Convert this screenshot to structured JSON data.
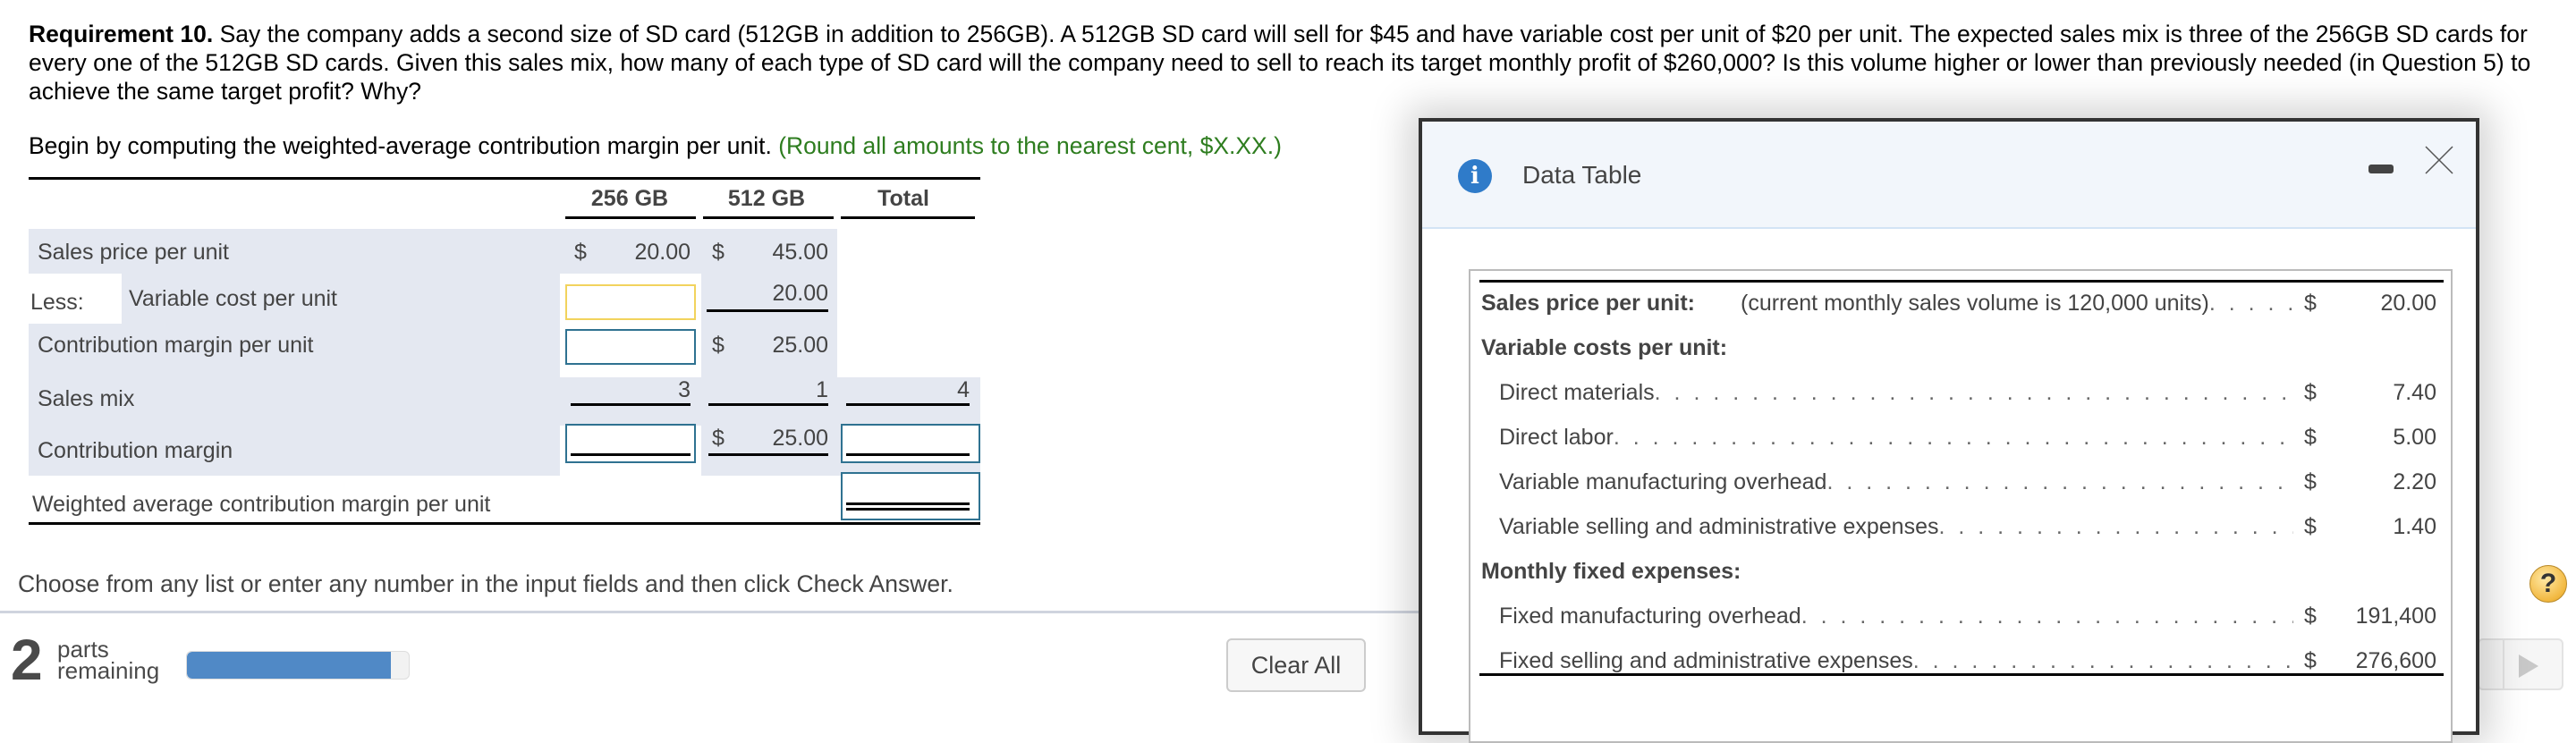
{
  "question": {
    "label": "Requirement 10.",
    "text": "Say the company adds a second size of SD card (512GB in addition to 256GB). A 512GB SD card will sell for $45 and have variable cost per unit of $20 per unit. The expected sales mix is three of the 256GB SD cards for every one of the 512GB SD cards. Given this sales mix, how many of each type of SD card will the company need to sell to reach its target monthly profit of $260,000? Is this volume higher or lower than previously needed (in Question 5) to achieve the same target profit? Why?"
  },
  "instruction": {
    "text": "Begin by computing the weighted-average contribution margin per unit.",
    "hint": "(Round all amounts to the nearest cent, $X.XX.)"
  },
  "worksheet": {
    "columns": [
      "256 GB",
      "512 GB",
      "Total"
    ],
    "rows": {
      "sales_price": {
        "label": "Sales price per unit",
        "c256_dollar": "$",
        "c256": "20.00",
        "c512_dollar": "$",
        "c512": "45.00"
      },
      "variable_cost": {
        "prefix": "Less:",
        "label": "Variable cost per unit",
        "c256_input": "",
        "c512": "20.00"
      },
      "cm_per_unit": {
        "label": "Contribution margin per unit",
        "c256_input": "",
        "c512_dollar": "$",
        "c512": "25.00"
      },
      "sales_mix": {
        "label": "Sales mix",
        "c256": "3",
        "c512": "1",
        "total": "4"
      },
      "contribution_margin": {
        "label": "Contribution margin",
        "c256_input": "",
        "c512_dollar": "$",
        "c512": "25.00",
        "total_input": ""
      },
      "weighted_avg": {
        "label": "Weighted average contribution margin per unit",
        "total_input": ""
      }
    }
  },
  "footer": {
    "choose_text": "Choose from any list or enter any number in the input fields and then click Check Answer.",
    "parts_count": "2",
    "parts_label_1": "parts",
    "parts_label_2": "remaining",
    "progress_percent": 92,
    "clear_all_label": "Clear All",
    "help_label": "?"
  },
  "modal": {
    "title": "Data Table",
    "info_glyph": "i",
    "rows": [
      {
        "label": "Sales price per unit:",
        "bold": true,
        "note": "(current monthly sales volume is 120,000 units)",
        "dots": ". . . . .",
        "dollar": "$",
        "value": "20.00"
      },
      {
        "label": "Variable costs per unit:",
        "bold": true
      },
      {
        "label": "Direct materials",
        "dots": ". . . . . . . . . . . . . . . . . . . . . . . . . . . . . . . . . . . . . . . . . . . . . . . . . . .",
        "dollar": "$",
        "value": "7.40"
      },
      {
        "label": "Direct labor",
        "dots": ". . . . . . . . . . . . . . . . . . . . . . . . . . . . . . . . . . . . . . . . . . . . . . . . . . . . .",
        "dollar": "$",
        "value": "5.00"
      },
      {
        "label": "Variable manufacturing overhead",
        "dots": ". . . . . . . . . . . . . . . . . . . . . . . . . . . . . . . . . . .",
        "dollar": "$",
        "value": "2.20"
      },
      {
        "label": "Variable selling and administrative expenses",
        "dots": ". . . . . . . . . . . . . . . . . . . . . . . . . . .",
        "dollar": "$",
        "value": "1.40"
      },
      {
        "label": "Monthly fixed expenses:",
        "bold": true
      },
      {
        "label": "Fixed manufacturing overhead",
        "dots": ". . . . . . . . . . . . . . . . . . . . . . . . . . . . . . . . . . . . .",
        "dollar": "$",
        "value": "191,400"
      },
      {
        "label": "Fixed selling and administrative expenses",
        "dots": ". . . . . . . . . . . . . . . . . . . . . . . . . . . . .",
        "dollar": "$",
        "value": "276,600"
      }
    ]
  },
  "colors": {
    "hint_green": "#2e7d1f",
    "row_shade": "#e4e8f1",
    "input_border": "#2f7291",
    "input_focus": "#f2d35d",
    "progress_fill": "#5089c6",
    "info_blue": "#2f7bc9"
  }
}
